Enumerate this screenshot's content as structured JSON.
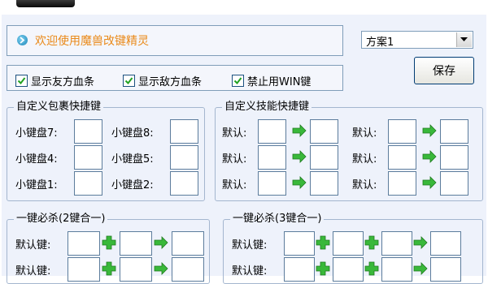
{
  "welcome": {
    "text": "欢迎使用魔兽改键精灵"
  },
  "options": [
    {
      "label": "显示友方血条",
      "checked": true
    },
    {
      "label": "显示敌方血条",
      "checked": true
    },
    {
      "label": "禁止用WIN键",
      "checked": true
    }
  ],
  "scheme_select": {
    "value": "方案1"
  },
  "save_button": {
    "label": "保存"
  },
  "item_hotkeys": {
    "title": "自定义包裹快捷键",
    "slots": [
      {
        "label": "小键盘7:",
        "value": ""
      },
      {
        "label": "小键盘8:",
        "value": ""
      },
      {
        "label": "小键盘4:",
        "value": ""
      },
      {
        "label": "小键盘5:",
        "value": ""
      },
      {
        "label": "小键盘1:",
        "value": ""
      },
      {
        "label": "小键盘2:",
        "value": ""
      }
    ]
  },
  "skill_hotkeys": {
    "title": "自定义技能快捷键",
    "default_label": "默认:",
    "rows": 3,
    "columns": 2
  },
  "combo2": {
    "title": "一键必杀(2键合一)",
    "key_label": "默认键:"
  },
  "combo3": {
    "title": "一键必杀(3键合一)",
    "key_label": "默认键:"
  },
  "icons": {
    "arrow": "green-right-arrow-icon",
    "plus": "green-plus-icon",
    "welcome": "blue-circle-arrow-icon"
  },
  "colors": {
    "panel_bg": "#eef2fb",
    "welcome_text": "#ea8a1a",
    "green_icon": "#39b83a",
    "border": "#7f9db9"
  }
}
